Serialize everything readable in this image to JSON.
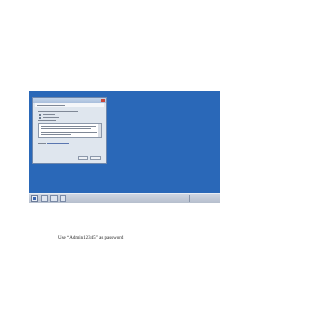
{
  "caption": "Use “Admin12345” as password"
}
